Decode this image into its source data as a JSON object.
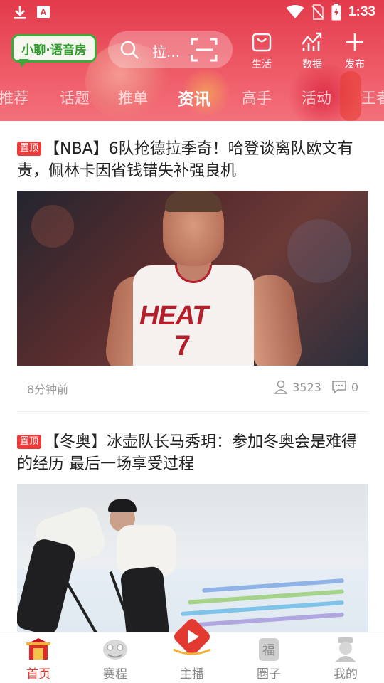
{
  "status_bar": {
    "time": "1:33"
  },
  "app": {
    "logo_text": "小聊·语音房"
  },
  "search": {
    "placeholder": "拉..."
  },
  "header_actions": [
    {
      "label": "生活",
      "icon": "shopping-bag-icon"
    },
    {
      "label": "数据",
      "icon": "chart-icon"
    },
    {
      "label": "发布",
      "icon": "plus-icon"
    }
  ],
  "tabs": [
    "推荐",
    "话题",
    "推单",
    "资讯",
    "高手",
    "活动",
    "王者"
  ],
  "active_tab": "资讯",
  "articles": [
    {
      "pin": "置顶",
      "title": "【NBA】6队抢德拉季奇！哈登谈离队欧文有责，佩林卡因省钱错失补强良机",
      "time": "8分钟前",
      "views": "3523",
      "comments": "0"
    },
    {
      "pin": "置顶",
      "title": "【冬奥】冰壶队长马秀玥：参加冬奥会是难得的经历 最后一场享受过程"
    }
  ],
  "bottom_nav": [
    {
      "label": "首页",
      "icon": "home-lantern-icon",
      "active": true
    },
    {
      "label": "赛程",
      "icon": "lion-dance-icon",
      "active": false
    },
    {
      "label": "主播",
      "icon": "play-live-icon",
      "active": false
    },
    {
      "label": "圈子",
      "icon": "fu-tile-icon",
      "active": false
    },
    {
      "label": "我的",
      "icon": "profile-figure-icon",
      "active": false
    }
  ],
  "colors": {
    "brand_red": "#e23a4b",
    "pin_red": "#ea3c3c",
    "logo_green": "#3ea93a"
  }
}
